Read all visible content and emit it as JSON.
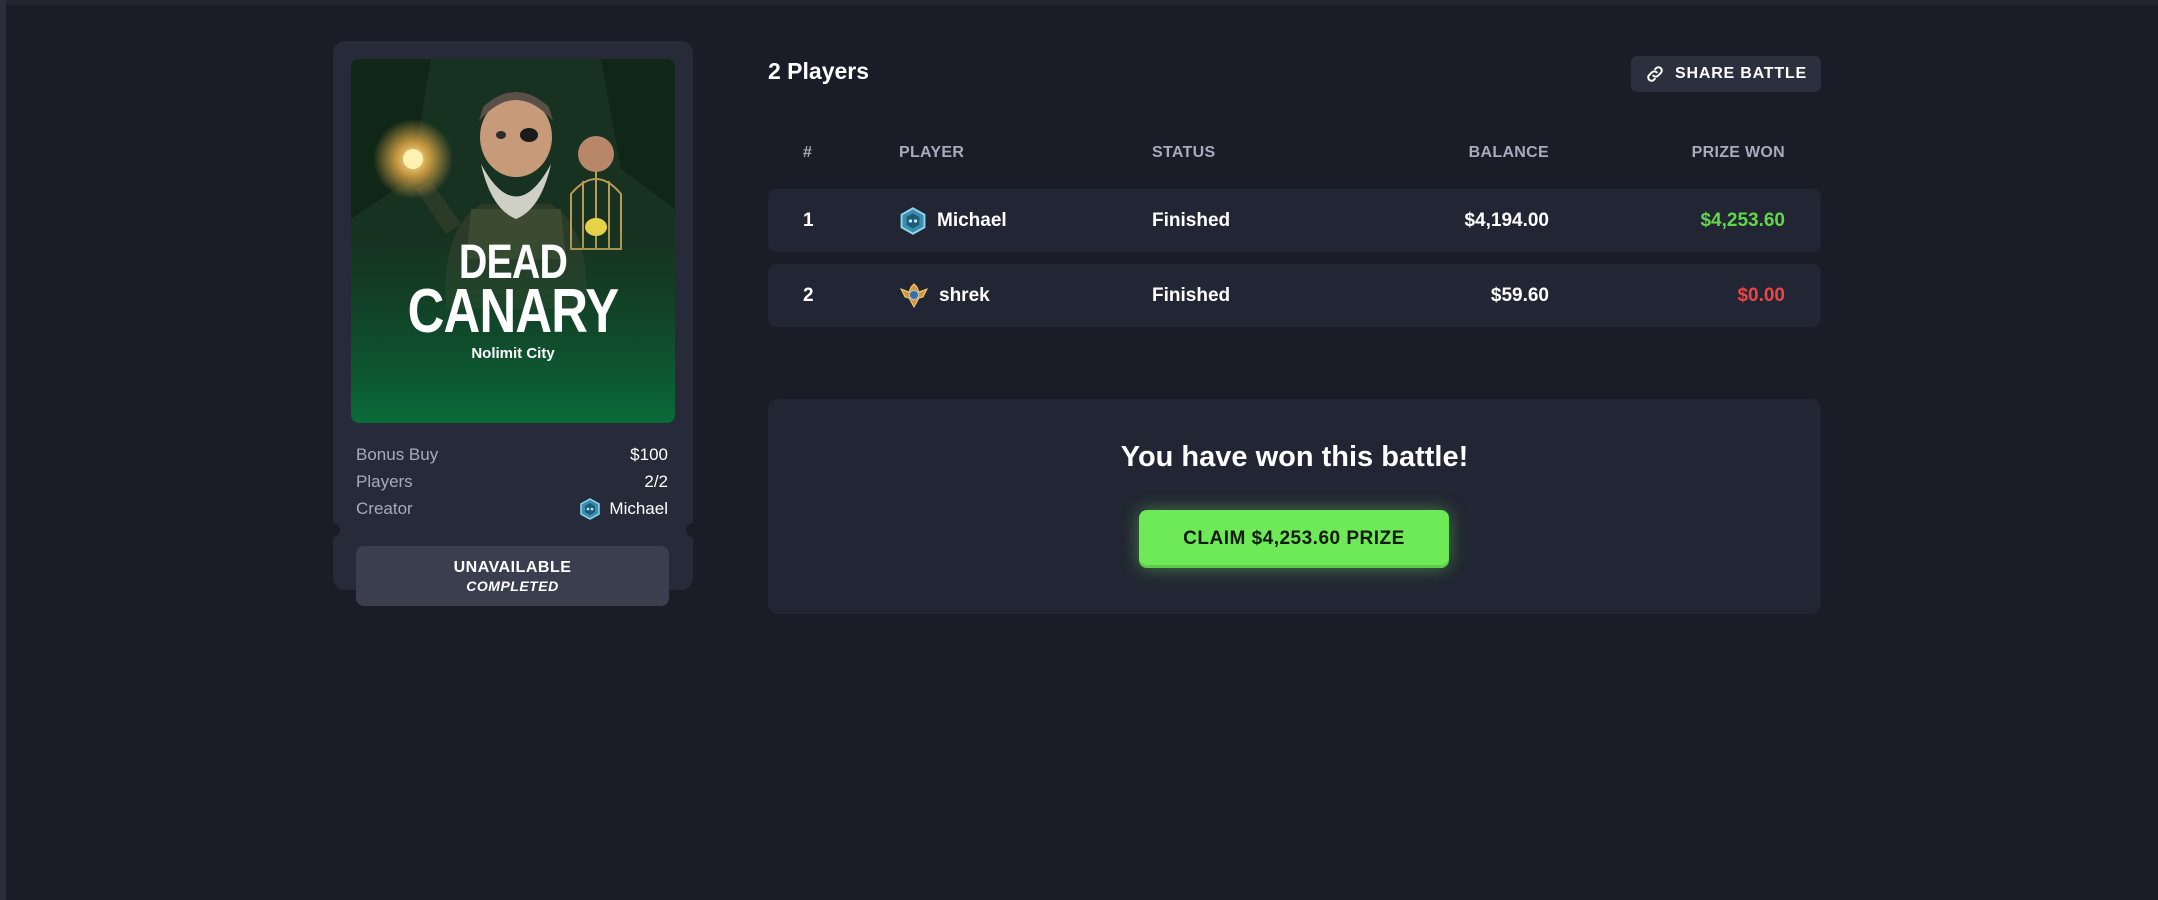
{
  "slot": {
    "title_line1": "DEAD",
    "title_line2": "CANARY",
    "studio": "Nolimit City",
    "info": {
      "bonus_buy_label": "Bonus Buy",
      "bonus_buy_value": "$100",
      "players_label": "Players",
      "players_value": "2/2",
      "creator_label": "Creator",
      "creator_value": "Michael"
    },
    "status": {
      "line1": "UNAVAILABLE",
      "line2": "COMPLETED"
    }
  },
  "header": {
    "players_title": "2 Players",
    "share_label": "SHARE BATTLE"
  },
  "table": {
    "columns": [
      "#",
      "PLAYER",
      "STATUS",
      "BALANCE",
      "PRIZE WON"
    ],
    "rows": [
      {
        "rank": "1",
        "player": "Michael",
        "avatar": "blue-hex-badge-icon",
        "status": "Finished",
        "balance": "$4,194.00",
        "prize": "$4,253.60"
      },
      {
        "rank": "2",
        "player": "shrek",
        "avatar": "gold-wing-badge-icon",
        "status": "Finished",
        "balance": "$59.60",
        "prize": "$0.00"
      }
    ]
  },
  "result": {
    "title": "You have won this battle!",
    "claim_label": "CLAIM $4,253.60 PRIZE"
  },
  "colors": {
    "background": "#1a1c27",
    "panel": "#222533",
    "win": "#62d74a",
    "lose": "#ec4545",
    "claim": "#6ee957"
  }
}
